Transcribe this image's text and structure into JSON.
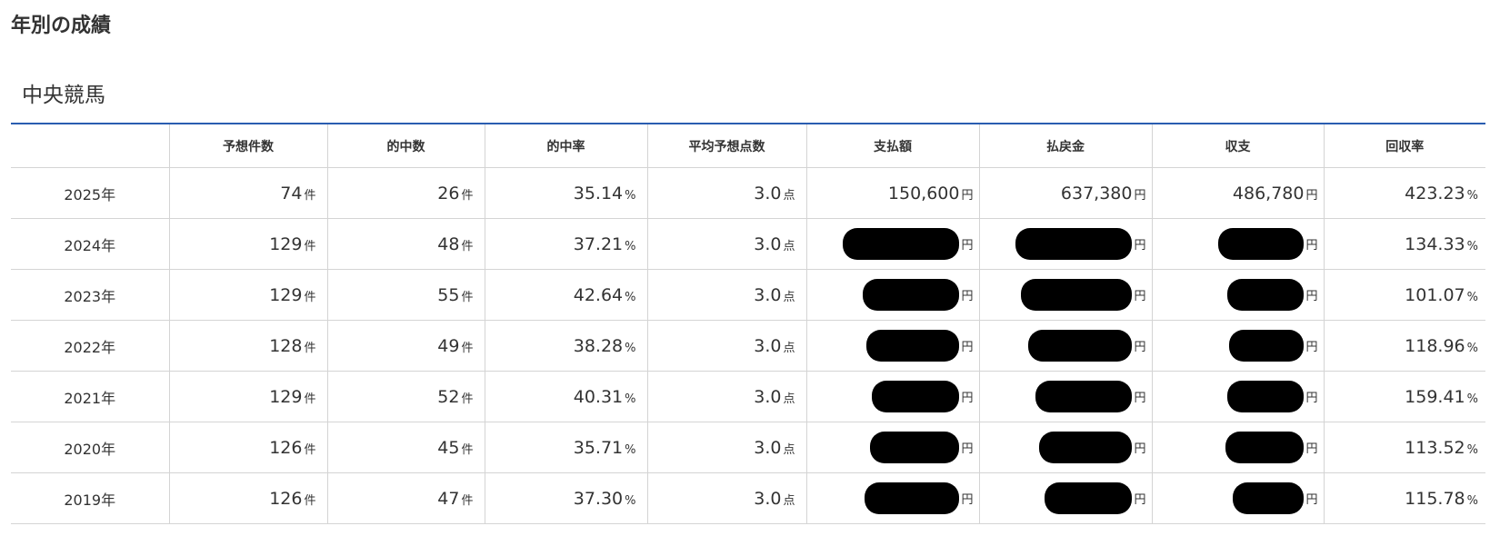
{
  "page": {
    "title": "年別の成績",
    "section_title": "中央競馬"
  },
  "table": {
    "columns": [
      "",
      "予想件数",
      "的中数",
      "的中率",
      "平均予想点数",
      "支払額",
      "払戻金",
      "収支",
      "回収率"
    ],
    "units": {
      "count": "件",
      "percent": "%",
      "points": "点",
      "yen": "円"
    },
    "rows": [
      {
        "year": "2025年",
        "predictions": "74",
        "hits": "26",
        "hit_rate": "35.14",
        "avg_points": "3.0",
        "paid": "150,600",
        "payout": "637,380",
        "balance": "486,780",
        "return_rate": "423.23",
        "redacted": false
      },
      {
        "year": "2024年",
        "predictions": "129",
        "hits": "48",
        "hit_rate": "37.21",
        "avg_points": "3.0",
        "paid": "",
        "payout": "",
        "balance": "",
        "return_rate": "134.33",
        "redacted": true
      },
      {
        "year": "2023年",
        "predictions": "129",
        "hits": "55",
        "hit_rate": "42.64",
        "avg_points": "3.0",
        "paid": "",
        "payout": "",
        "balance": "",
        "return_rate": "101.07",
        "redacted": true
      },
      {
        "year": "2022年",
        "predictions": "128",
        "hits": "49",
        "hit_rate": "38.28",
        "avg_points": "3.0",
        "paid": "",
        "payout": "",
        "balance": "",
        "return_rate": "118.96",
        "redacted": true
      },
      {
        "year": "2021年",
        "predictions": "129",
        "hits": "52",
        "hit_rate": "40.31",
        "avg_points": "3.0",
        "paid": "",
        "payout": "",
        "balance": "",
        "return_rate": "159.41",
        "redacted": true
      },
      {
        "year": "2020年",
        "predictions": "126",
        "hits": "45",
        "hit_rate": "35.71",
        "avg_points": "3.0",
        "paid": "",
        "payout": "",
        "balance": "",
        "return_rate": "113.52",
        "redacted": true
      },
      {
        "year": "2019年",
        "predictions": "126",
        "hits": "47",
        "hit_rate": "37.30",
        "avg_points": "3.0",
        "paid": "",
        "payout": "",
        "balance": "",
        "return_rate": "115.78",
        "redacted": true
      }
    ]
  },
  "colors": {
    "accent_border": "#2a5db0",
    "cell_border": "#d4d4d4",
    "redaction": "#000000"
  }
}
